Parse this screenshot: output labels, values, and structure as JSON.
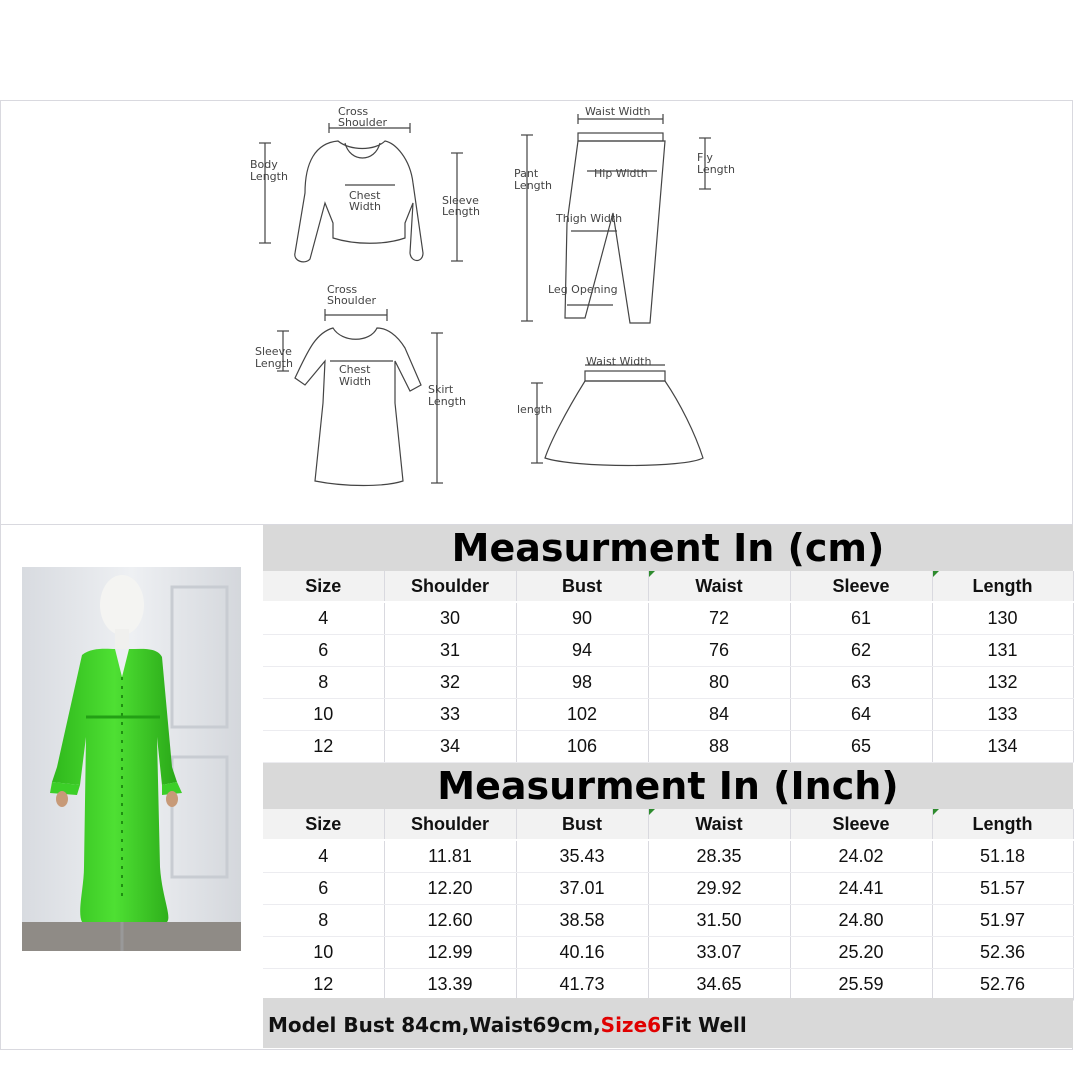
{
  "diagram": {
    "top_labels": {
      "cross_shoulder_1": "Cross\nShoulder",
      "body_length": "Body\nLength",
      "chest_width_1": "Chest\nWidth",
      "sleeve_length_1": "Sleeve\nLength",
      "waist_width_1": "Waist Width",
      "pant_length": "Pant\nLength",
      "hip_width": "Hip Width",
      "fly_length": "Fly\nLength",
      "thigh_width": "Thigh Width",
      "leg_opening": "Leg Opening",
      "cross_shoulder_2": "Cross\nShoulder",
      "sleeve_length_2": "Sleeve\nLength",
      "chest_width_2": "Chest\nWidth",
      "skirt_length": "Skirt\nLength",
      "waist_width_2": "Waist Width",
      "length": "length"
    }
  },
  "cm_table": {
    "title": "Measurment In (cm)",
    "headers": [
      "Size",
      "Shoulder",
      "Bust",
      "Waist",
      "Sleeve",
      "Length"
    ],
    "rows": [
      [
        "4",
        "30",
        "90",
        "72",
        "61",
        "130"
      ],
      [
        "6",
        "31",
        "94",
        "76",
        "62",
        "131"
      ],
      [
        "8",
        "32",
        "98",
        "80",
        "63",
        "132"
      ],
      [
        "10",
        "33",
        "102",
        "84",
        "64",
        "133"
      ],
      [
        "12",
        "34",
        "106",
        "88",
        "65",
        "134"
      ]
    ]
  },
  "inch_table": {
    "title": "Measurment In (Inch)",
    "headers": [
      "Size",
      "Shoulder",
      "Bust",
      "Waist",
      "Sleeve",
      "Length"
    ],
    "rows": [
      [
        "4",
        "11.81",
        "35.43",
        "28.35",
        "24.02",
        "51.18"
      ],
      [
        "6",
        "12.20",
        "37.01",
        "29.92",
        "24.41",
        "51.57"
      ],
      [
        "8",
        "12.60",
        "38.58",
        "31.50",
        "24.80",
        "51.97"
      ],
      [
        "10",
        "12.99",
        "40.16",
        "33.07",
        "25.20",
        "52.36"
      ],
      [
        "12",
        "13.39",
        "41.73",
        "34.65",
        "25.59",
        "52.76"
      ]
    ]
  },
  "note": {
    "prefix": "Model Bust 84cm,Waist69cm,",
    "highlight": "Size6",
    "suffix": "Fit Well",
    "highlight_color": "#e00000"
  },
  "colors": {
    "header_bg": "#f2f2f2",
    "title_bg": "#d9d9d9",
    "dress_green": "#3fd12a"
  }
}
